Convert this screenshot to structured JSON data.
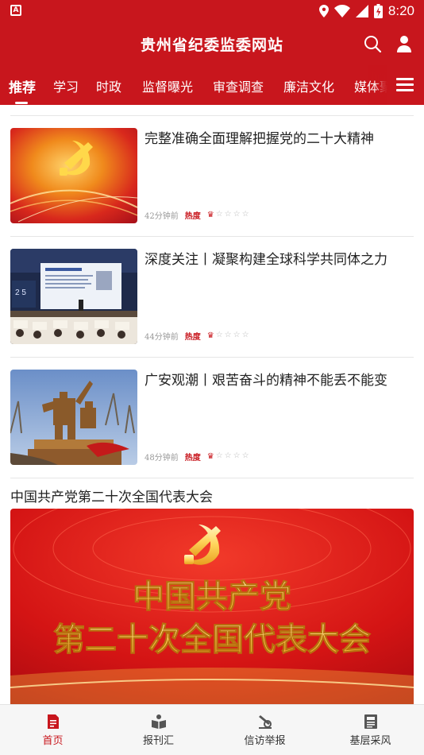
{
  "status": {
    "time": "8:20",
    "app_icon": "A"
  },
  "header": {
    "title": "贵州省纪委监委网站"
  },
  "tabs": [
    {
      "label": "推荐",
      "active": true
    },
    {
      "label": "学习"
    },
    {
      "label": "时政"
    },
    {
      "label": "监督曝光"
    },
    {
      "label": "审查调查"
    },
    {
      "label": "廉洁文化"
    },
    {
      "label": "媒体聚"
    }
  ],
  "articles": [
    {
      "title": "完整准确全面理解把握党的二十大精神",
      "time": "42分钟前",
      "hot_label": "热度",
      "heat": 1,
      "thumb": "party-emblem-gold"
    },
    {
      "title": "深度关注丨凝聚构建全球科学共同体之力",
      "time": "44分钟前",
      "hot_label": "热度",
      "heat": 1,
      "thumb": "conference-hall"
    },
    {
      "title": "广安观潮丨艰苦奋斗的精神不能丢不能变",
      "time": "48分钟前",
      "hot_label": "热度",
      "heat": 1,
      "thumb": "bronze-statue"
    }
  ],
  "section": {
    "title": "中国共产党第二十次全国代表大会",
    "banner_line1": "中国共产党",
    "banner_line2": "第二十次全国代表大会"
  },
  "bottom_nav": [
    {
      "label": "首页",
      "icon": "home-doc-icon",
      "active": true
    },
    {
      "label": "报刊汇",
      "icon": "book-icon"
    },
    {
      "label": "信访举报",
      "icon": "pen-report-icon"
    },
    {
      "label": "基层采风",
      "icon": "newspaper-icon"
    }
  ],
  "colors": {
    "brand": "#c8161d",
    "text": "#222222",
    "muted": "#999999"
  }
}
